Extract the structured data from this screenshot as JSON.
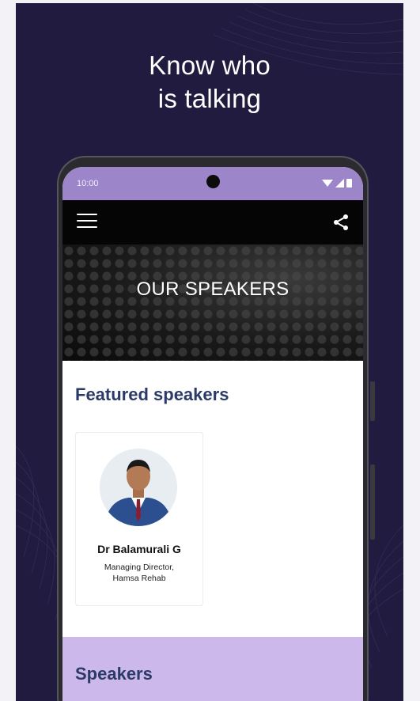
{
  "headline": {
    "line1": "Know who",
    "line2": "is talking"
  },
  "status_bar": {
    "time": "10:00",
    "icons": [
      "wifi-icon",
      "signal-icon",
      "battery-icon"
    ]
  },
  "toolbar": {
    "menu_icon": "hamburger-menu-icon",
    "share_icon": "share-icon"
  },
  "banner": {
    "title": "OUR SPEAKERS"
  },
  "featured": {
    "heading": "Featured speakers",
    "speakers": [
      {
        "name": "Dr Balamurali G",
        "role_line1": "Managing Director,",
        "role_line2": "Hamsa Rehab"
      }
    ]
  },
  "speakers_section": {
    "heading": "Speakers"
  },
  "colors": {
    "poster_bg": "#211c3f",
    "status_bar": "#9c85c9",
    "heading_text": "#2b3a66",
    "speakers_section_bg": "#cdb8ec"
  }
}
